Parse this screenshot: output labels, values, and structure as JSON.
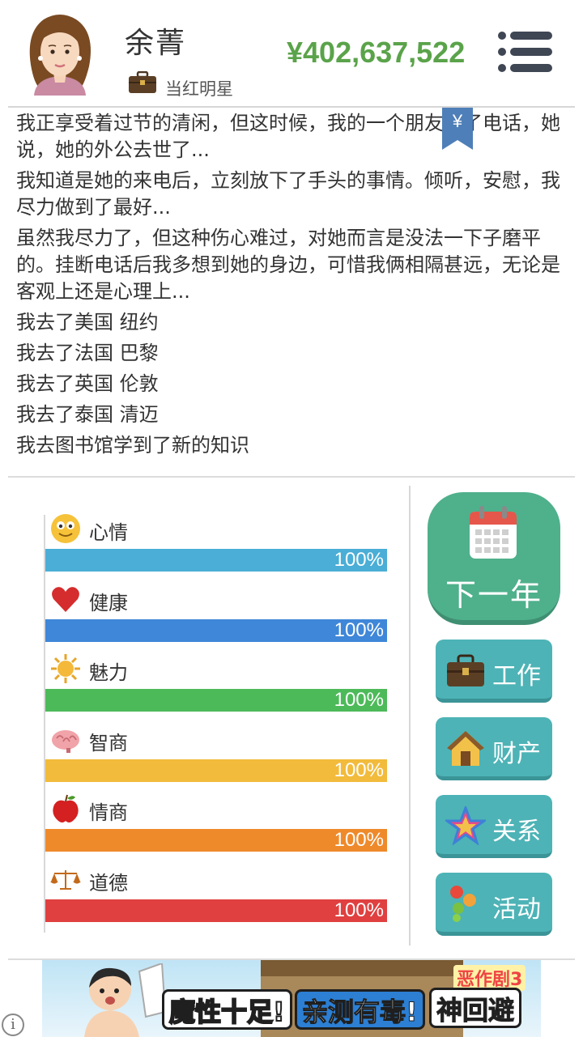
{
  "player": {
    "name": "余菁",
    "job": "当红明星",
    "money": "¥402,637,522"
  },
  "log": [
    "我正享受着过节的清闲，但这时候，我的一个朋友来了电话，她说，她的外公去世了...",
    "我知道是她的来电后，立刻放下了手头的事情。倾听，安慰，我尽力做到了最好...",
    "虽然我尽力了，但这种伤心难过，对她而言是没法一下子磨平的。挂断电话后我多想到她的身边，可惜我俩相隔甚远，无论是客观上还是心理上...",
    "我去了美国 纽约",
    "我去了法国 巴黎",
    "我去了英国 伦敦",
    "我去了泰国 清迈",
    "我去图书馆学到了新的知识"
  ],
  "bookmark_symbol": "¥",
  "stats": [
    {
      "label": "心情",
      "value": 100,
      "display": "100%",
      "color": "#4aaed6",
      "icon": "smiley-face-icon"
    },
    {
      "label": "健康",
      "value": 100,
      "display": "100%",
      "color": "#3f87d8",
      "icon": "heart-icon"
    },
    {
      "label": "魅力",
      "value": 100,
      "display": "100%",
      "color": "#4dba5a",
      "icon": "sun-icon"
    },
    {
      "label": "智商",
      "value": 100,
      "display": "100%",
      "color": "#f2bb3c",
      "icon": "brain-icon"
    },
    {
      "label": "情商",
      "value": 100,
      "display": "100%",
      "color": "#ef8a2b",
      "icon": "apple-icon"
    },
    {
      "label": "道德",
      "value": 100,
      "display": "100%",
      "color": "#e04040",
      "icon": "scales-icon"
    }
  ],
  "actions": {
    "next_year": "下一年",
    "work": "工作",
    "assets": "财产",
    "relations": "关系",
    "activities": "活动"
  },
  "ad": {
    "text1": "魔性十足!",
    "text2": "亲测有毒!",
    "text3": "神回避",
    "tag": "恶作剧3",
    "info": "i"
  }
}
